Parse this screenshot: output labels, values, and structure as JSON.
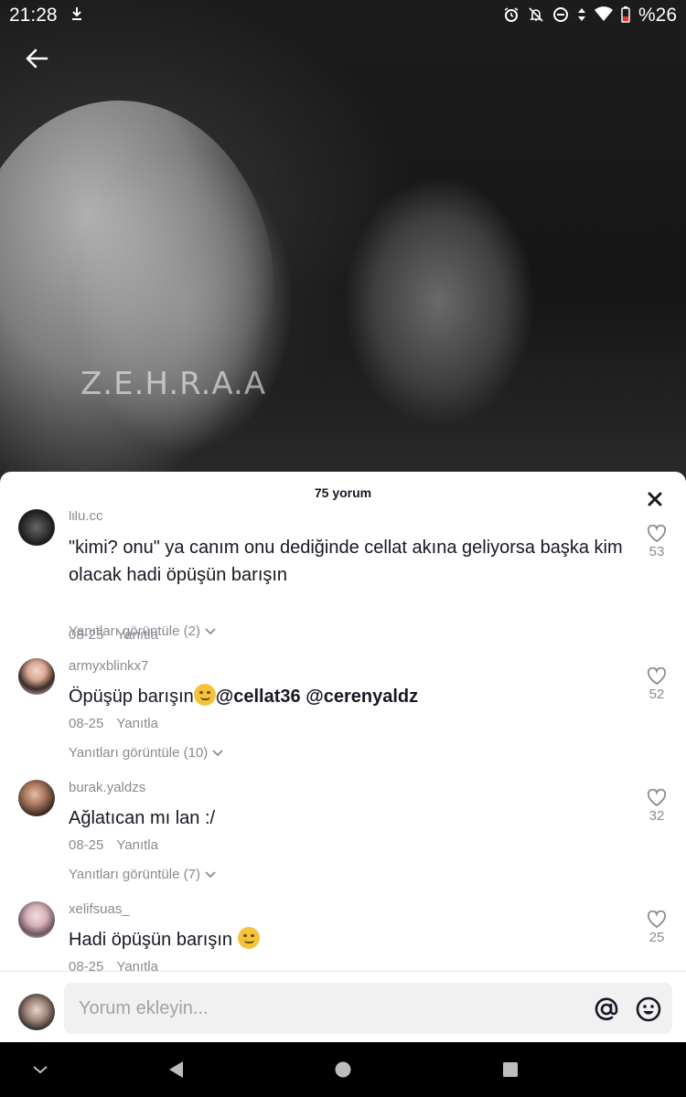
{
  "status_bar": {
    "time": "21:28",
    "battery": "%26",
    "icons": [
      "download-icon",
      "alarm-icon",
      "notifications-off-icon",
      "do-not-disturb-icon",
      "data-icon",
      "wifi-icon",
      "battery-icon"
    ]
  },
  "video": {
    "watermark": "Z.E.H.R.A.A"
  },
  "sheet": {
    "title": "75 yorum",
    "comments": [
      {
        "username": "lilu.cc",
        "text": "\"kimi? onu\" ya canım onu dediğinde cellat akına geliyorsa başka kim olacak hadi öpüşün barışın",
        "date": "08-25",
        "reply_label": "Yanıtla",
        "likes": "53",
        "view_replies": "Yanıtları görüntüle (2)"
      },
      {
        "username": "armyxblinkx7",
        "text": "Öpüşüp barışın",
        "mention1": "@cellat36",
        "mention2": "@cerenyaldz",
        "date": "08-25",
        "reply_label": "Yanıtla",
        "likes": "52",
        "view_replies": "Yanıtları görüntüle (10)"
      },
      {
        "username": "burak.yaldzs",
        "text": "Ağlatıcan mı lan :/",
        "date": "08-25",
        "reply_label": "Yanıtla",
        "likes": "32",
        "view_replies": "Yanıtları görüntüle (7)"
      },
      {
        "username": "xelifsuas_",
        "text": "Hadi öpüşün barışın",
        "date": "08-25",
        "reply_label": "Yanıtla",
        "likes": "25"
      }
    ]
  },
  "input": {
    "placeholder": "Yorum ekleyin..."
  },
  "colors": {
    "text_primary": "#161823",
    "text_secondary": "#8a8b91",
    "input_bg": "#f1f1f2"
  }
}
